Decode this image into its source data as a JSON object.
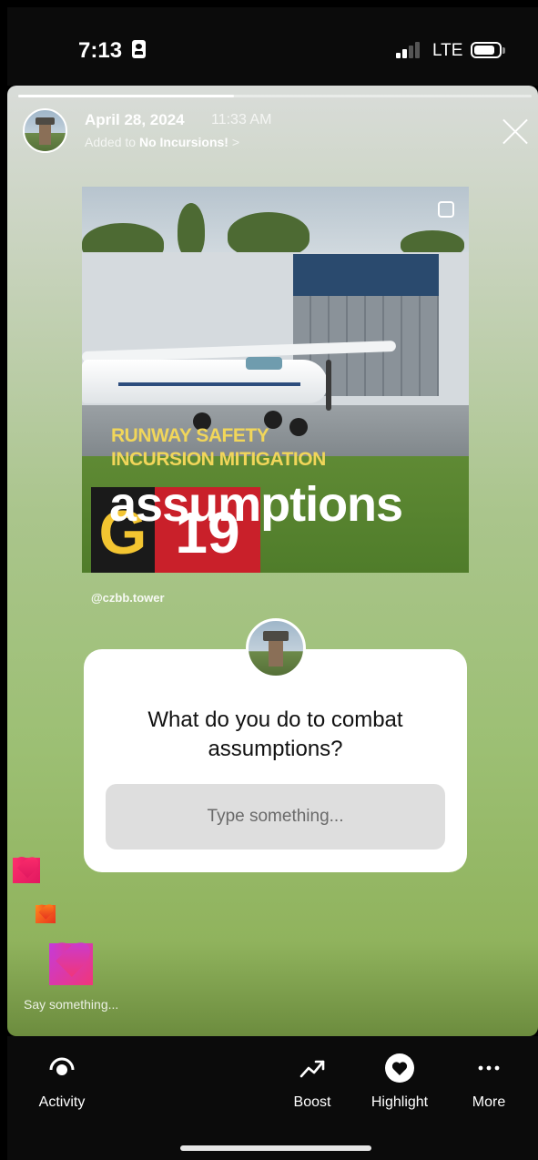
{
  "status_bar": {
    "time": "7:13",
    "network": "LTE",
    "signal_bars_active": 2,
    "signal_bars_total": 4,
    "battery_level": 0.85
  },
  "story": {
    "progress": 0.42,
    "header": {
      "date": "April 28, 2024",
      "time": "11:33 AM",
      "added_prefix": "Added to",
      "highlight_name": "No Incursions!",
      "chevron": ">"
    },
    "post": {
      "title_line1": "RUNWAY SAFETY",
      "title_line2": "INCURSION MITIGATION",
      "headline": "assumptions",
      "sign_letter": "G",
      "sign_number": "19",
      "handle": "@czbb.tower"
    },
    "question": {
      "prompt": "What do you do to combat assumptions?",
      "placeholder": "Type something..."
    },
    "reply_placeholder": "Say something...",
    "hearts": [
      {
        "color_a": "#ff2f6d",
        "color_b": "#e01860"
      },
      {
        "color_a": "#ff8a1c",
        "color_b": "#e8331f"
      },
      {
        "color_a": "#c53bd9",
        "color_b": "#f0367a"
      }
    ]
  },
  "bottom_bar": {
    "activity_label": "Activity",
    "boost_label": "Boost",
    "highlight_label": "Highlight",
    "more_label": "More"
  },
  "colors": {
    "accent_white": "#ffffff",
    "sign_red": "#c9202a",
    "sign_yellow": "#f3c531"
  }
}
